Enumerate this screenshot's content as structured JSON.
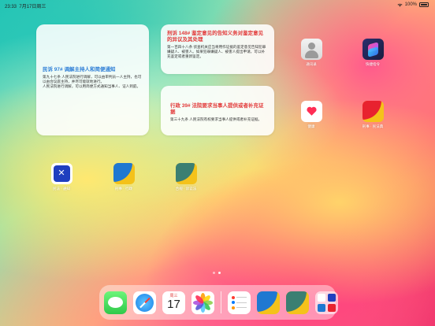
{
  "status": {
    "time": "23:33",
    "date": "7月17日周三",
    "battery": "100%"
  },
  "widgets": {
    "w1": {
      "title": "民诉 97# 调解主持人和简便通知",
      "body": "第九十七条 人民法院进行调解，可以由审判员一人主持，也可以由合议庭主持，并尽可能就地进行。\n人民法院进行调解，可以用简便方式通知当事人、证人到庭。"
    },
    "w2": {
      "title": "刑诉 148# 鉴定意见的告知义务对鉴定意见的异议及其处理",
      "body": "第一百四十八条 侦查机关应当将用作证据的鉴定意见告知犯罪嫌疑人、被害人。如果犯罪嫌疑人、被害人提出申请，可以补充鉴定或者重新鉴定。"
    },
    "w3": {
      "title": "行政 39# 法院要求当事人提供或者补充证据",
      "body": "第三十九条 人民法院有权要求当事人提供或者补充证据。"
    }
  },
  "apps": {
    "contacts": {
      "label": "通讯录"
    },
    "shortcuts": {
      "label": "快捷指令"
    },
    "health": {
      "label": "健康"
    },
    "law_app1": {
      "label": "刑事 · 民法典"
    },
    "law_app2": {
      "label": "民法 · 通知"
    },
    "law_app3": {
      "label": "刑事 · 行政"
    },
    "law_app4": {
      "label": "合规 · 诉讼法"
    }
  },
  "dock": {
    "calendar_weekday": "周三",
    "calendar_day": "17"
  },
  "colors": {
    "widget_title_blue": "#2f7fd6",
    "widget_title_red": "#e23a3a"
  }
}
